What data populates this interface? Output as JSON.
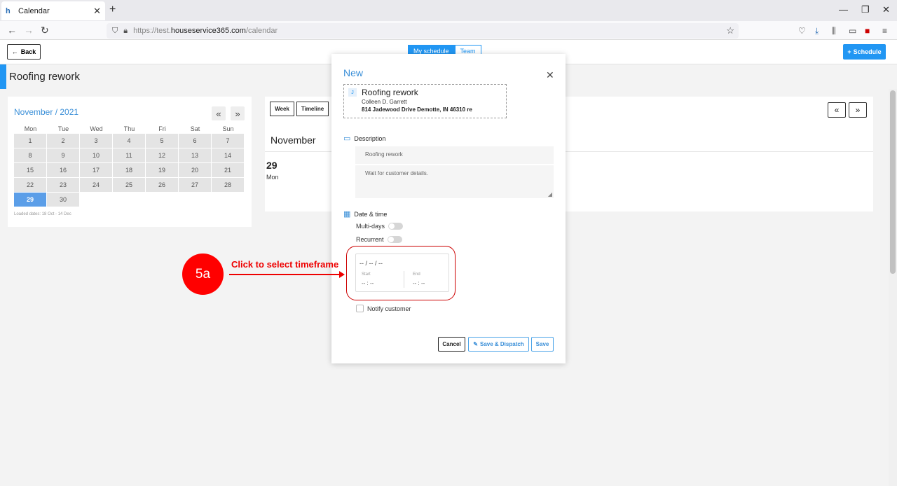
{
  "browser": {
    "tab_title": "Calendar",
    "url_prefix": "https://test.",
    "url_domain": "houseservice365.com",
    "url_path": "/calendar"
  },
  "header": {
    "back_label": "Back",
    "toggle": [
      "My schedule",
      "Team"
    ],
    "schedule_label": "Schedule"
  },
  "page": {
    "title": "Roofing rework"
  },
  "mini_calendar": {
    "month_label": "November / 2021",
    "weekdays": [
      "Mon",
      "Tue",
      "Wed",
      "Thu",
      "Fri",
      "Sat",
      "Sun"
    ],
    "days": [
      "1",
      "2",
      "3",
      "4",
      "5",
      "6",
      "7",
      "8",
      "9",
      "10",
      "11",
      "12",
      "13",
      "14",
      "15",
      "16",
      "17",
      "18",
      "19",
      "20",
      "21",
      "22",
      "23",
      "24",
      "25",
      "26",
      "27",
      "28",
      "29",
      "30"
    ],
    "selected_day": "29",
    "loaded_dates": "Loaded dates: 18 Oct - 14 Dec"
  },
  "main_calendar": {
    "views": [
      "Week",
      "Timeline"
    ],
    "month": "November",
    "day_number": "29",
    "day_name": "Mon"
  },
  "modal": {
    "title": "New",
    "job": {
      "badge": "J",
      "title": "Roofing rework",
      "customer": "Colleen D. Garrett",
      "address": "814 Jadewood Drive Demotte, IN 46310 re"
    },
    "description_label": "Description",
    "description_title": "Roofing rework",
    "description_notes": "Wait for customer details.",
    "datetime_label": "Date & time",
    "multi_days_label": "Multi-days",
    "recurrent_label": "Recurrent",
    "date_placeholder": "-- / -- / --",
    "start_label": "Start",
    "end_label": "End",
    "start_value": "-- : --",
    "end_value": "-- : --",
    "notify_label": "Notify customer",
    "cancel_label": "Cancel",
    "dispatch_label": "Save & Dispatch",
    "save_label": "Save"
  },
  "annotation": {
    "step": "5a",
    "text": "Click to select timeframe",
    "color": "#ff0000"
  }
}
